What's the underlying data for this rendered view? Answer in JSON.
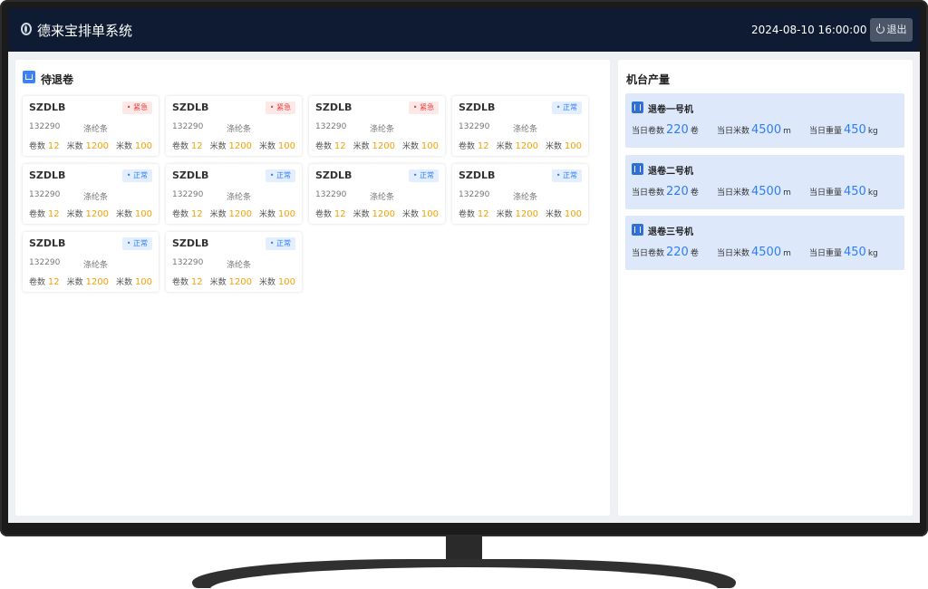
{
  "header": {
    "app_title": "德来宝排单系统",
    "datetime": "2024-08-10 16:00:00",
    "logout_label": "退出"
  },
  "pending": {
    "title": "待退卷",
    "labels": {
      "rolls": "卷数",
      "meters": "米数"
    },
    "cards": [
      {
        "code": "SZDLB",
        "status": "紧急",
        "status_type": "urgent",
        "order_no": "132290",
        "material": "涤纶条",
        "rolls": "12",
        "meters": "1200",
        "meters2": "100"
      },
      {
        "code": "SZDLB",
        "status": "紧急",
        "status_type": "urgent",
        "order_no": "132290",
        "material": "涤纶条",
        "rolls": "12",
        "meters": "1200",
        "meters2": "100"
      },
      {
        "code": "SZDLB",
        "status": "紧急",
        "status_type": "urgent",
        "order_no": "132290",
        "material": "涤纶条",
        "rolls": "12",
        "meters": "1200",
        "meters2": "100"
      },
      {
        "code": "SZDLB",
        "status": "正常",
        "status_type": "normal",
        "order_no": "132290",
        "material": "涤纶条",
        "rolls": "12",
        "meters": "1200",
        "meters2": "100"
      },
      {
        "code": "SZDLB",
        "status": "正常",
        "status_type": "normal",
        "order_no": "132290",
        "material": "涤纶条",
        "rolls": "12",
        "meters": "1200",
        "meters2": "100"
      },
      {
        "code": "SZDLB",
        "status": "正常",
        "status_type": "normal",
        "order_no": "132290",
        "material": "涤纶条",
        "rolls": "12",
        "meters": "1200",
        "meters2": "100"
      },
      {
        "code": "SZDLB",
        "status": "正常",
        "status_type": "normal",
        "order_no": "132290",
        "material": "涤纶条",
        "rolls": "12",
        "meters": "1200",
        "meters2": "100"
      },
      {
        "code": "SZDLB",
        "status": "正常",
        "status_type": "normal",
        "order_no": "132290",
        "material": "涤纶条",
        "rolls": "12",
        "meters": "1200",
        "meters2": "100"
      },
      {
        "code": "SZDLB",
        "status": "正常",
        "status_type": "normal",
        "order_no": "132290",
        "material": "涤纶条",
        "rolls": "12",
        "meters": "1200",
        "meters2": "100"
      },
      {
        "code": "SZDLB",
        "status": "正常",
        "status_type": "normal",
        "order_no": "132290",
        "material": "涤纶条",
        "rolls": "12",
        "meters": "1200",
        "meters2": "100"
      }
    ]
  },
  "output": {
    "title": "机台产量",
    "labels": {
      "rolls": "当日卷数",
      "meters": "当日米数",
      "weight": "当日重量"
    },
    "units": {
      "rolls": "卷",
      "meters": "m",
      "weight": "kg"
    },
    "machines": [
      {
        "name": "退卷一号机",
        "rolls": "220",
        "meters": "4500",
        "weight": "450"
      },
      {
        "name": "退卷二号机",
        "rolls": "220",
        "meters": "4500",
        "weight": "450"
      },
      {
        "name": "退卷三号机",
        "rolls": "220",
        "meters": "4500",
        "weight": "450"
      }
    ]
  },
  "colors": {
    "header_bg": "#0e1b33",
    "accent_blue": "#2f7df6",
    "value_orange": "#f5a100",
    "urgent_red": "#e53e3e"
  }
}
